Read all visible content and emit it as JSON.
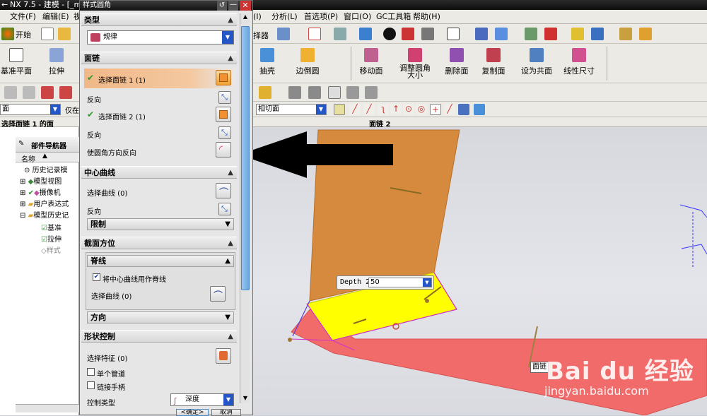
{
  "app": {
    "title": "NX 7.5 - 建模 - [_mo",
    "prefix": "←"
  },
  "menu": {
    "left": [
      "文件(F)",
      "编辑(E)",
      "视"
    ],
    "right": [
      "(I)",
      "分析(L)",
      "首选项(P)",
      "窗口(O)",
      "GC工具箱",
      "帮助(H)"
    ]
  },
  "toolbar": {
    "start_label": "开始",
    "selector_label": "择器",
    "features": [
      {
        "label": "抽壳",
        "color": "#4a90d9"
      },
      {
        "label": "边倒圆",
        "color": "#f0b030"
      },
      {
        "label": "移动面",
        "color": "#c06090"
      },
      {
        "label": "调整圆角大小",
        "label1": "调整圆角",
        "label2": "大小",
        "color": "#d04070"
      },
      {
        "label": "删除面",
        "color": "#9050b0"
      },
      {
        "label": "复制面",
        "color": "#c04050"
      },
      {
        "label": "设为共面",
        "color": "#5080c0"
      },
      {
        "label": "线性尺寸",
        "color": "#d05090"
      }
    ],
    "left_big": [
      {
        "label": "基准平面"
      },
      {
        "label": "拉伸"
      }
    ],
    "filter_left": "面",
    "filter_left2": "仅在",
    "filter_right": "相切面"
  },
  "status": {
    "left_prompt": "选择面链 1 的面",
    "right_prompt": "面链 2"
  },
  "navigator": {
    "title": "部件导航器",
    "column": "名称",
    "items": [
      {
        "label": "历史记录模",
        "indent": 0
      },
      {
        "label": "模型视图",
        "indent": 0
      },
      {
        "label": "摄像机",
        "indent": 0
      },
      {
        "label": "用户表达式",
        "indent": 0
      },
      {
        "label": "模型历史记",
        "indent": 0
      },
      {
        "label": "基准",
        "indent": 1
      },
      {
        "label": "拉伸",
        "indent": 1
      },
      {
        "label": "样式",
        "indent": 1
      }
    ]
  },
  "dialog": {
    "title": "样式圆角",
    "type_section": "类型",
    "type_value": "规律",
    "face_chain_section": "面链",
    "chain1": "选择面链 1 (1)",
    "reverse1": "反向",
    "chain2": "选择面链 2 (1)",
    "reverse2": "反向",
    "fillet_reverse": "使圆角方向反向",
    "center_curve_section": "中心曲线",
    "select_curve": "选择曲线 (0)",
    "reverse3": "反向",
    "limit_section": "限制",
    "section_orient": "截面方位",
    "spine_section": "脊线",
    "use_center_as_spine": "将中心曲线用作脊线",
    "select_curve2": "选择曲线 (0)",
    "direction_section": "方向",
    "shape_control": "形状控制",
    "select_feature": "选择特征 (0)",
    "single_pipe": "单个管道",
    "link_handles": "链接手柄",
    "control_type": "控制类型",
    "control_type_value": "深度",
    "ok": "<确定>",
    "cancel": "取消"
  },
  "viewport": {
    "depth_label": "Depth 2",
    "depth_value": "50",
    "face_tag": "面链"
  },
  "watermark": {
    "logo": "Bai du 经验",
    "url": "jingyan.baidu.com"
  }
}
